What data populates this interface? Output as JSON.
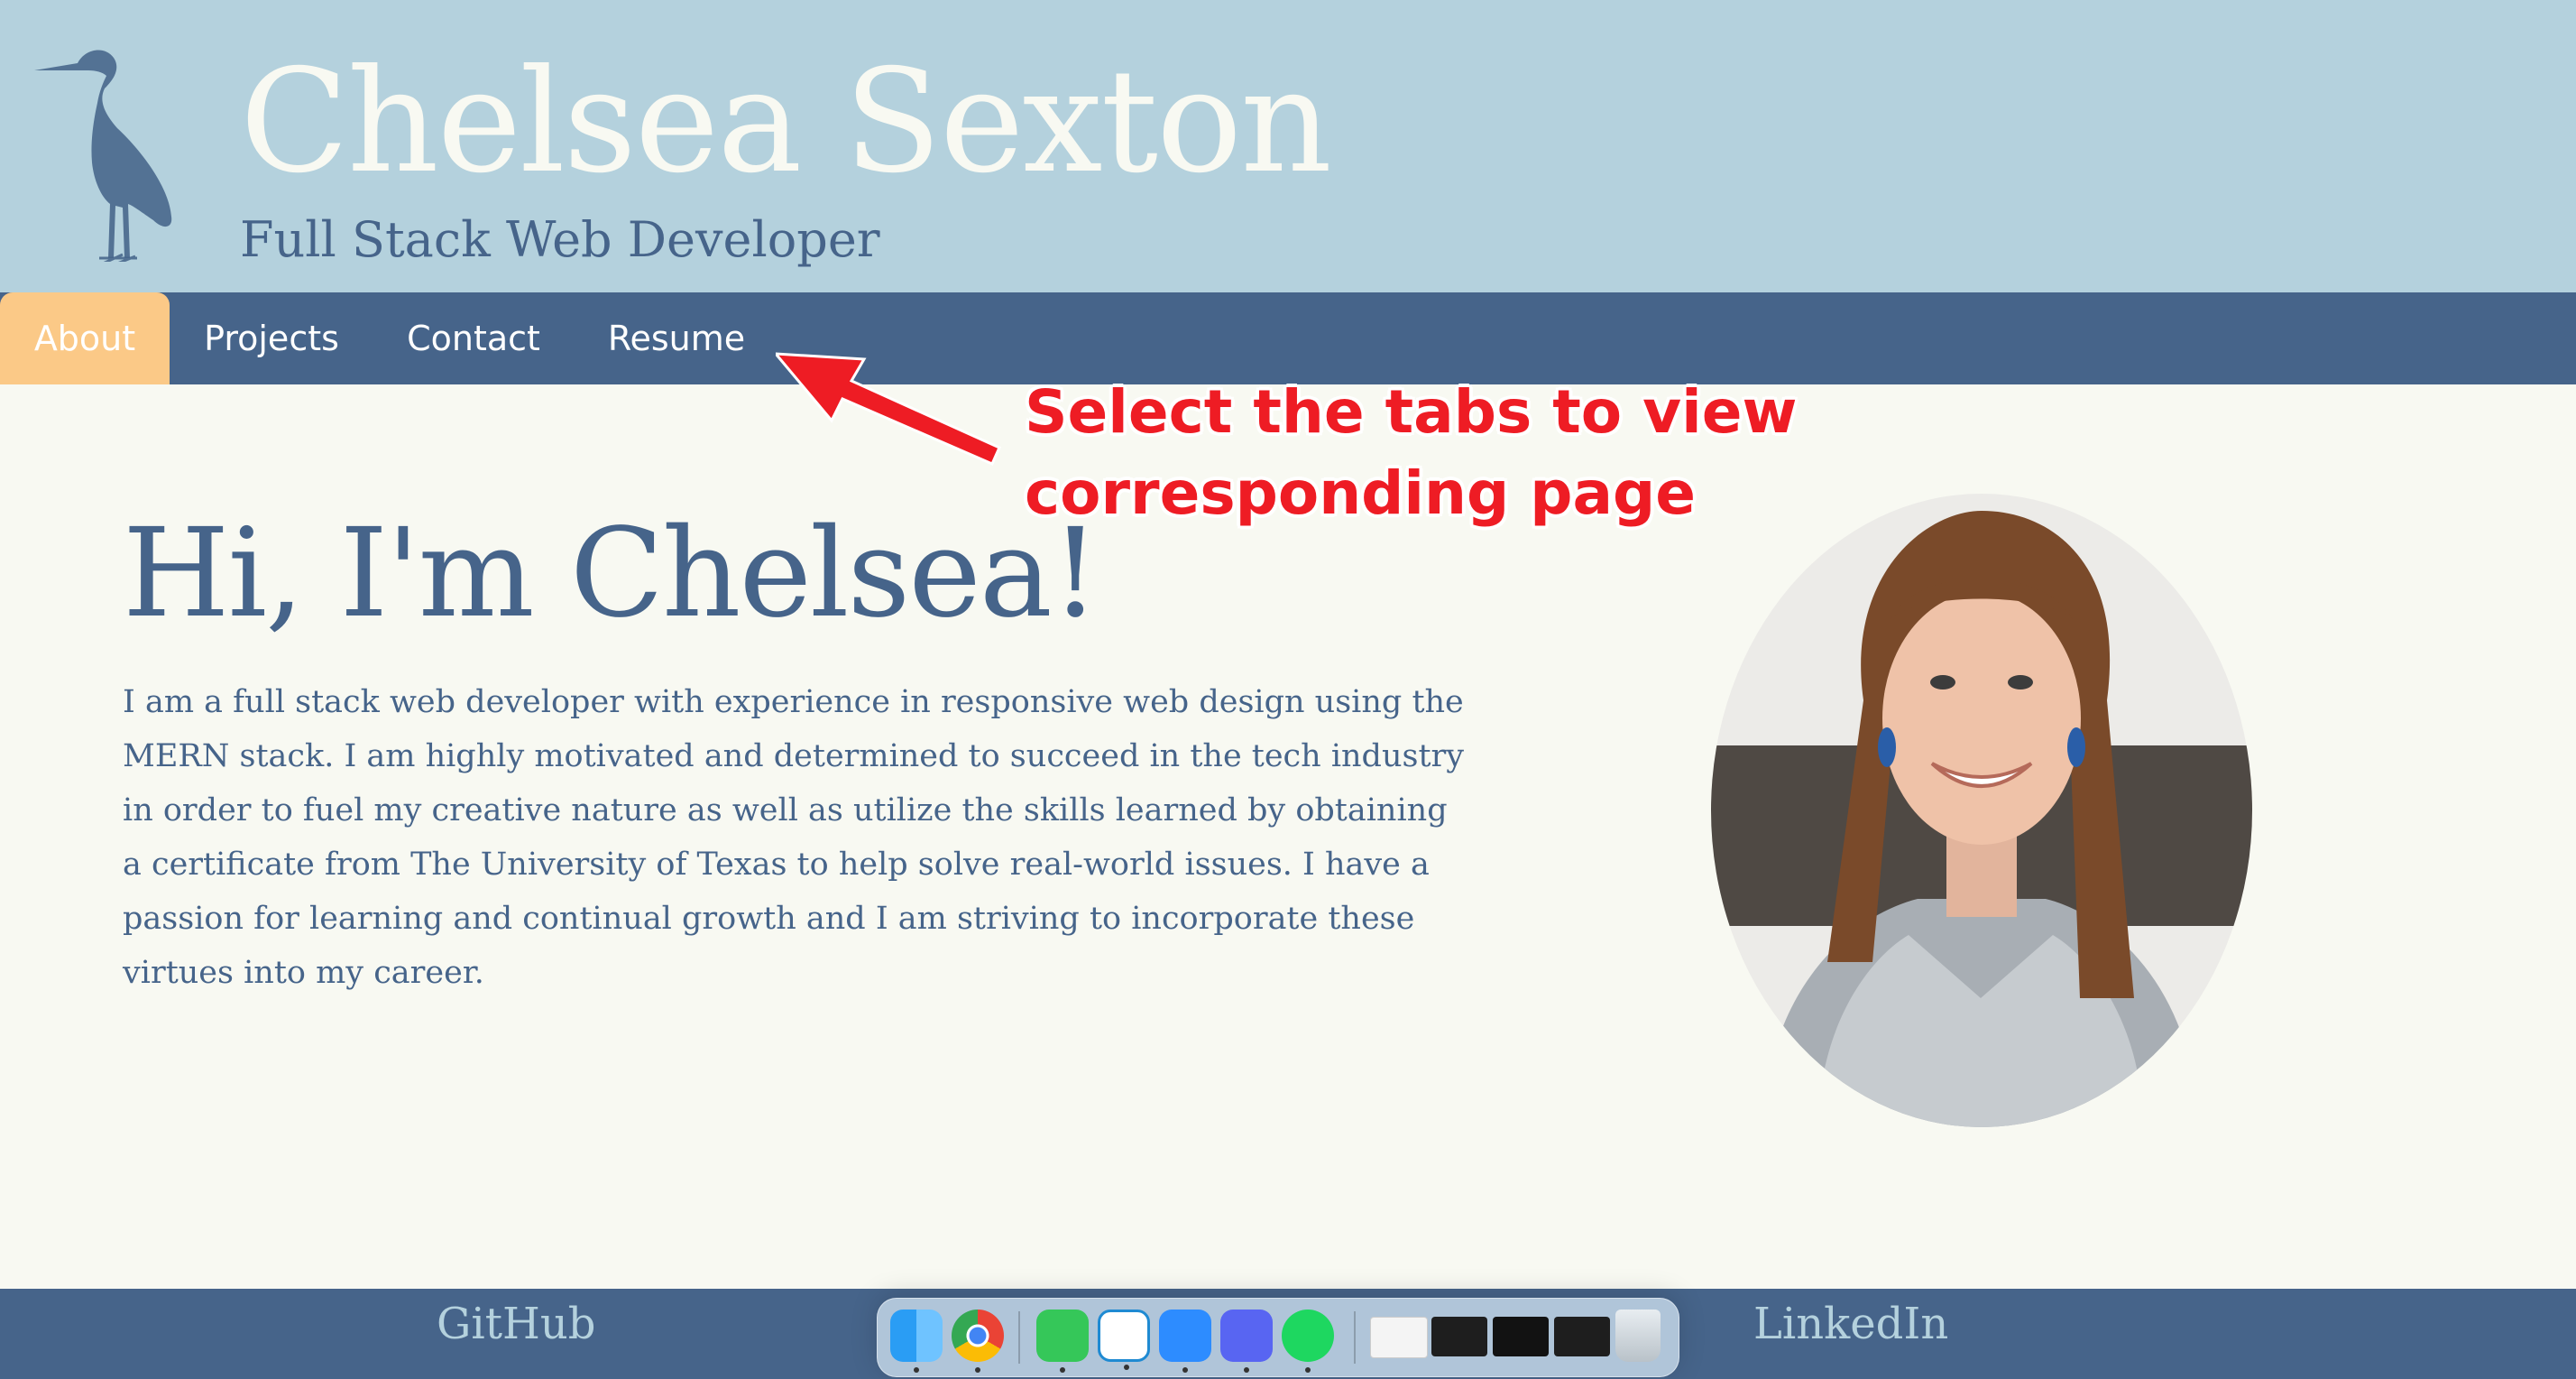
{
  "header": {
    "title": "Chelsea Sexton",
    "subtitle": "Full Stack Web Developer",
    "logo_icon": "heron-icon"
  },
  "nav": {
    "tabs": [
      {
        "label": "About",
        "active": true
      },
      {
        "label": "Projects",
        "active": false
      },
      {
        "label": "Contact",
        "active": false
      },
      {
        "label": "Resume",
        "active": false
      }
    ]
  },
  "annotation": {
    "line1": "Select the tabs to view",
    "line2": "corresponding page"
  },
  "about": {
    "greeting": "Hi, I'm Chelsea!",
    "bio": "I am a full stack web developer with experience in responsive web design using the MERN stack. I am highly motivated and determined to succeed in the tech industry in order to fuel my creative nature as well as utilize the skills learned by obtaining a certificate from The University of Texas to help solve real-world issues. I have a passion for learning and continual growth and I am striving to incorporate these virtues into my career."
  },
  "footer": {
    "github": "GitHub",
    "linkedin": "LinkedIn"
  },
  "dock": {
    "apps": [
      "finder-icon",
      "chrome-icon",
      "messages-icon",
      "vscode-icon",
      "zoom-icon",
      "discord-icon",
      "spotify-icon"
    ],
    "windows": [
      "chrome-window-thumbnail",
      "vscode-window-thumbnail",
      "spotify-window-thumbnail",
      "vscode-window-thumbnail-2"
    ],
    "trash": "trash-icon"
  },
  "colors": {
    "header_bg": "#b4d1dd",
    "nav_bg": "#46648a",
    "active_tab": "#fbc987",
    "page_bg": "#f8f9f2",
    "annotation": "#ee1c24"
  }
}
